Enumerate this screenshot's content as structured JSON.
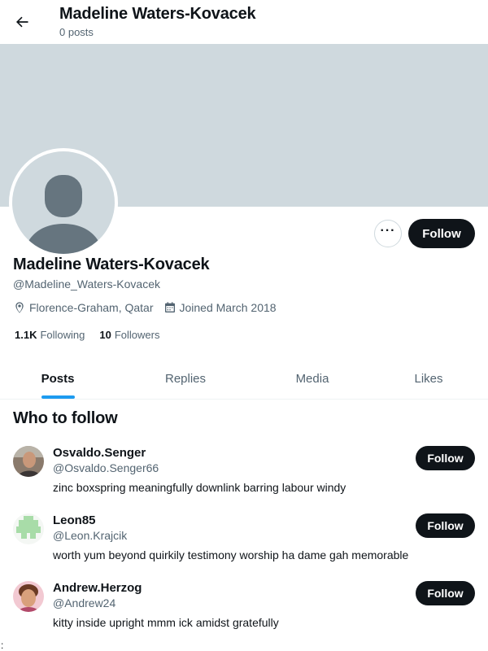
{
  "header": {
    "name": "Madeline Waters-Kovacek",
    "posts_count": "0 posts",
    "back_icon": "arrow-left-icon"
  },
  "profile": {
    "display_name": "Madeline Waters-Kovacek",
    "handle": "@Madeline_Waters-Kovacek",
    "location": "Florence-Graham, Qatar",
    "joined": "Joined March 2018",
    "following_count": "1.1K",
    "following_label": "Following",
    "followers_count": "10",
    "followers_label": "Followers",
    "follow_label": "Follow",
    "more_label": "···"
  },
  "tabs": [
    {
      "label": "Posts",
      "active": true
    },
    {
      "label": "Replies",
      "active": false
    },
    {
      "label": "Media",
      "active": false
    },
    {
      "label": "Likes",
      "active": false
    }
  ],
  "who_to_follow": {
    "title": "Who to follow",
    "users": [
      {
        "name": "Osvaldo.Senger",
        "handle": "@Osvaldo.Senger66",
        "bio": "zinc boxspring meaningfully downlink barring labour windy",
        "follow_label": "Follow"
      },
      {
        "name": "Leon85",
        "handle": "@Leon.Krajcik",
        "bio": "worth yum beyond quirkily testimony worship ha dame gah memorable",
        "follow_label": "Follow"
      },
      {
        "name": "Andrew.Herzog",
        "handle": "@Andrew24",
        "bio": "kitty inside upright mmm ick amidst gratefully",
        "follow_label": "Follow"
      }
    ]
  },
  "footer": {
    "mark": ":"
  },
  "colors": {
    "banner": "#cfd9de",
    "accent": "#1d9bf0",
    "text_primary": "#0f1419",
    "text_secondary": "#536471",
    "button_dark": "#0f1419"
  }
}
